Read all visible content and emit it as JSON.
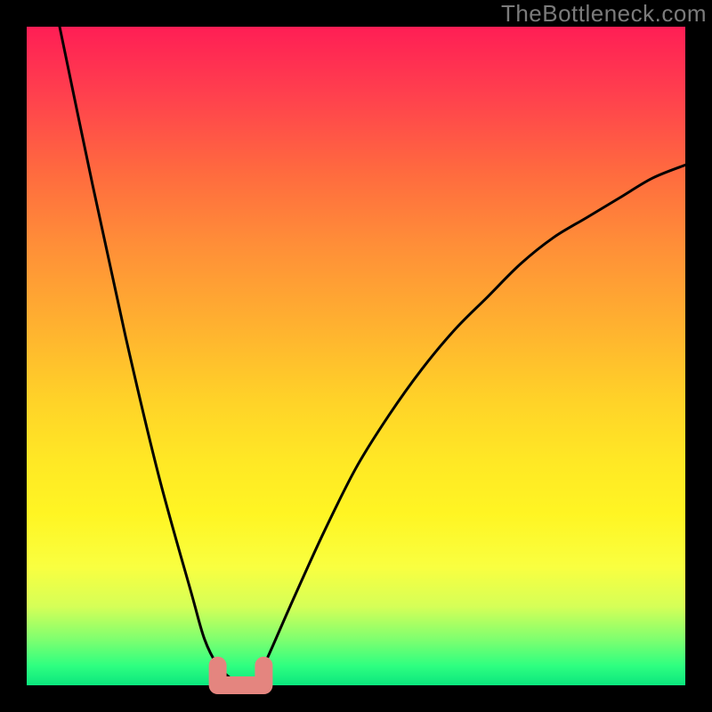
{
  "watermark": "TheBottleneck.com",
  "colors": {
    "background": "#000000",
    "curve": "#000000",
    "marker": "#e4857f",
    "gradient_top": "#ff1e55",
    "gradient_mid": "#ffe825",
    "gradient_bottom": "#0be67e"
  },
  "chart_data": {
    "type": "line",
    "title": "",
    "xlabel": "",
    "ylabel": "",
    "xlim": [
      0,
      100
    ],
    "ylim": [
      0,
      100
    ],
    "grid": false,
    "series": [
      {
        "name": "bottleneck-curve",
        "x": [
          5,
          10,
          15,
          20,
          25,
          27,
          29,
          31,
          32,
          33,
          34,
          36,
          40,
          45,
          50,
          55,
          60,
          65,
          70,
          75,
          80,
          85,
          90,
          95,
          100
        ],
        "y": [
          100,
          76,
          53,
          32,
          14,
          7,
          3,
          1,
          0,
          0,
          0,
          3,
          12,
          23,
          33,
          41,
          48,
          54,
          59,
          64,
          68,
          71,
          74,
          77,
          79
        ]
      }
    ],
    "markers": [
      {
        "name": "optimal-left",
        "x": 29,
        "y": 3
      },
      {
        "name": "optimal-right",
        "x": 36,
        "y": 3
      },
      {
        "name": "optimal-min",
        "x": 32.5,
        "y": 0
      }
    ]
  }
}
